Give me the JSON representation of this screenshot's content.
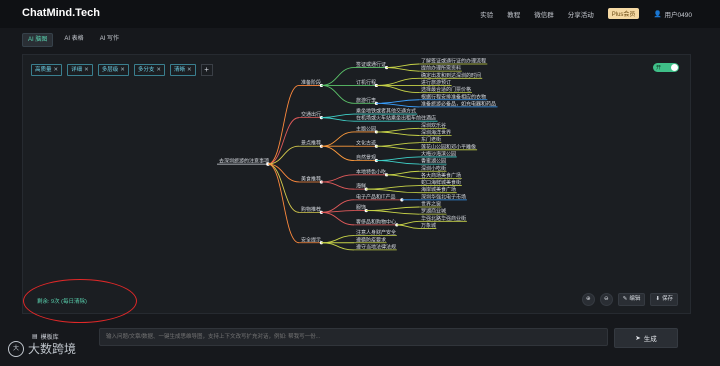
{
  "header": {
    "logo": "ChatMind.Tech",
    "nav": [
      "实验",
      "教程",
      "微信群",
      "分享活动"
    ],
    "plus_badge": "Plus会员",
    "user": "用户0490"
  },
  "tabs": [
    {
      "label": "AI 脑图",
      "active": true
    },
    {
      "label": "AI 表格",
      "active": false
    },
    {
      "label": "AI 写作",
      "active": false
    }
  ],
  "tags": [
    "高质量",
    "详细",
    "多层级",
    "多分支",
    "清晰"
  ],
  "toggle_label": "开",
  "mindmap": {
    "root": "去深圳旅游的注意事项",
    "branches": [
      {
        "label": "准备阶段",
        "color": "#ff8a3d",
        "children": [
          {
            "label": "签证或通行证",
            "color": "#5cc46a",
            "children": [
              {
                "label": "了解签证或通行证的办理流程",
                "color": "#c8d448"
              },
              {
                "label": "提前办理所需资料",
                "color": "#c8d448"
              }
            ]
          },
          {
            "label": "订机行程",
            "color": "#5cc46a",
            "children": [
              {
                "label": "确定出发和到达深圳的时间",
                "color": "#c8d448"
              },
              {
                "label": "进行旅游预订",
                "color": "#c8d448"
              },
              {
                "label": "选择最合适的门票价格",
                "color": "#c8d448"
              }
            ]
          },
          {
            "label": "旅游行李",
            "color": "#5cc46a",
            "children": [
              {
                "label": "根据行程安排准备相应的衣物",
                "color": "#3aa0ff"
              },
              {
                "label": "准备旅游必备品，如充电器和药品",
                "color": "#3aa0ff"
              }
            ]
          }
        ]
      },
      {
        "label": "交通出行",
        "color": "#e05a5a",
        "children": [
          {
            "label": "乘坐地铁或者其他交通方式",
            "color": "#3fd0c8"
          },
          {
            "label": "在机场或火车站乘坐出租车前往酒店",
            "color": "#3fd0c8"
          }
        ]
      },
      {
        "label": "景点推荐",
        "color": "#d4c94c",
        "children": [
          {
            "label": "主题公园",
            "color": "#ff9b3d",
            "children": [
              {
                "label": "深圳欢乐谷",
                "color": "#c8d448"
              },
              {
                "label": "深圳海洋世界",
                "color": "#c8d448"
              }
            ]
          },
          {
            "label": "文化古迹",
            "color": "#ff9b3d",
            "children": [
              {
                "label": "东门老街",
                "color": "#c8d448"
              },
              {
                "label": "莲花山公园和邓小平雕像",
                "color": "#c8d448"
              }
            ]
          },
          {
            "label": "自然景观",
            "color": "#ff9b3d",
            "children": [
              {
                "label": "大梅沙海滨公园",
                "color": "#3fd0c8"
              },
              {
                "label": "香蜜湖公园",
                "color": "#3fd0c8"
              }
            ]
          }
        ]
      },
      {
        "label": "美食推荐",
        "color": "#ff8a3d",
        "children": [
          {
            "label": "本地特色小吃",
            "color": "#e05a5a",
            "children": [
              {
                "label": "深圳小吃街",
                "color": "#c8d448"
              },
              {
                "label": "各大商场美食广场",
                "color": "#c8d448"
              }
            ]
          },
          {
            "label": "海鲜",
            "color": "#e05a5a",
            "children": [
              {
                "label": "蛇口海鲜城美食街",
                "color": "#c8d448"
              },
              {
                "label": "海岸城美食广场",
                "color": "#c8d448"
              }
            ]
          }
        ]
      },
      {
        "label": "购物推荐",
        "color": "#d4c94c",
        "children": [
          {
            "label": "电子产品和IT产品",
            "color": "#e05a5a",
            "children": [
              {
                "label": "深圳华强北电子市场",
                "color": "#3aa0ff"
              }
            ]
          },
          {
            "label": "服饰",
            "color": "#e05a5a",
            "children": [
              {
                "label": "世界之窗",
                "color": "#c8d448"
              },
              {
                "label": "罗湖商业城",
                "color": "#c8d448"
              }
            ]
          },
          {
            "label": "奢侈品和购物中心",
            "color": "#e05a5a",
            "children": [
              {
                "label": "华强北路华强商业街",
                "color": "#c8d448"
              },
              {
                "label": "万象城",
                "color": "#c8d448"
              }
            ]
          }
        ]
      },
      {
        "label": "安全提示",
        "color": "#ff8a3d",
        "children": [
          {
            "label": "注意人身财产安全",
            "color": "#c8d448"
          },
          {
            "label": "遵循防疫要求",
            "color": "#c8d448"
          },
          {
            "label": "遵守当地法律法规",
            "color": "#c8d448"
          }
        ]
      }
    ]
  },
  "quota_text": "剩余: 9次 (每日清除)",
  "tools": {
    "edit": "编辑",
    "save": "保存"
  },
  "bottom": {
    "template_label": "模板库",
    "input_placeholder": "输入问题/文章/数据、一键生成思维导图，支持上下文改写扩充对话，例如: 帮我写一份...",
    "generate_label": "生成"
  },
  "watermark": "大数跨境"
}
